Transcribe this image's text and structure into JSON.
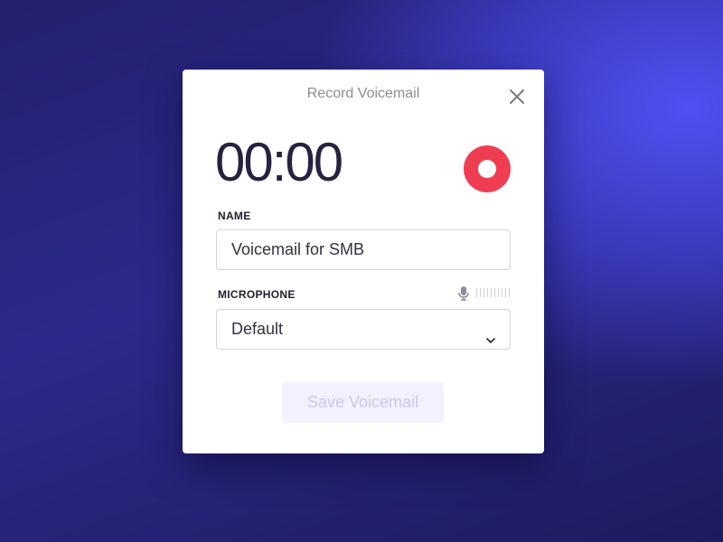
{
  "dialog": {
    "title": "Record Voicemail",
    "close_icon": "close-icon"
  },
  "recorder": {
    "timer": "00:00",
    "record_icon": "record-icon",
    "record_color": "#ef3e52"
  },
  "name_field": {
    "label": "NAME",
    "value": "Voicemail for SMB"
  },
  "microphone_field": {
    "label": "MICROPHONE",
    "selected": "Default",
    "mic_icon": "microphone-icon",
    "level": 0
  },
  "actions": {
    "save_label": "Save Voicemail",
    "save_enabled": false
  },
  "colors": {
    "accent": "#5150f2",
    "disabled_button_bg": "#f3f1fd",
    "disabled_button_text": "#cbc7ef"
  }
}
